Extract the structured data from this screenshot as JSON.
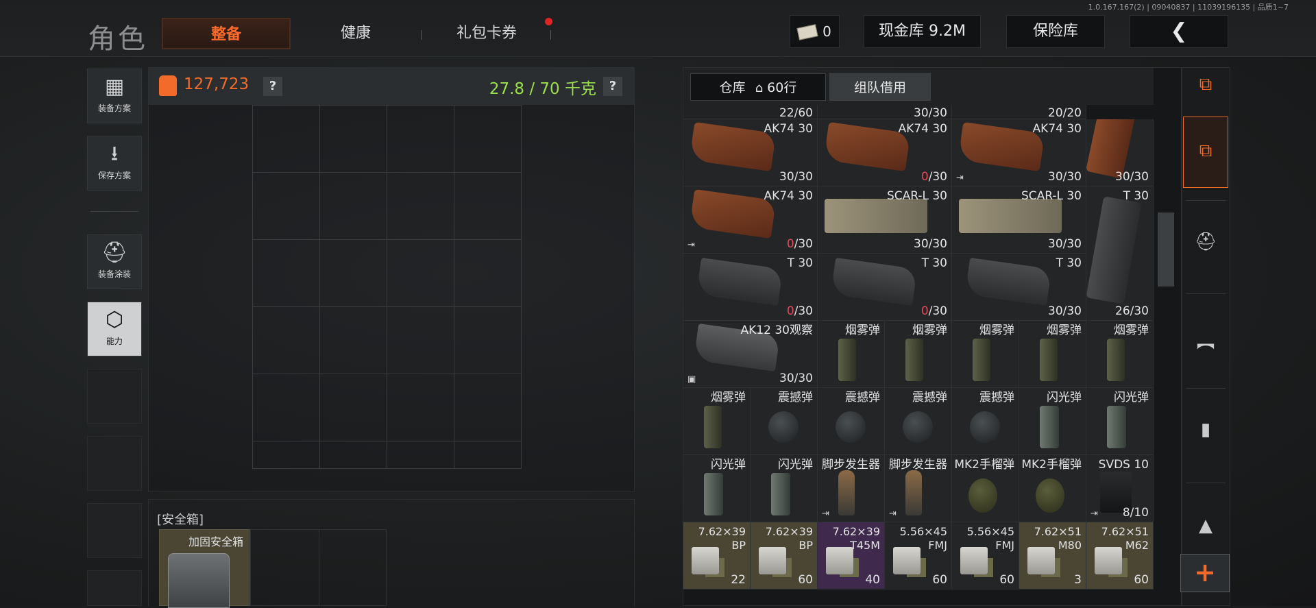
{
  "version": "1.0.167.167(2) | 09040837 | 11039196135 | 品质1~7",
  "header": {
    "brand": "角色",
    "tabs": [
      "整备",
      "健康",
      "礼包卡券"
    ],
    "currency_value": "0",
    "cash": "现金库 9.2M",
    "vault": "保险库",
    "back": "❮"
  },
  "sidebar": {
    "loadout": "装备方案",
    "save": "保存方案",
    "skin": "装备涂装",
    "ability": "能力"
  },
  "equip": {
    "value": "127,723",
    "weight": "27.8 / 70 千克",
    "help": "?"
  },
  "safe_box": {
    "title": "[安全箱]",
    "item": "加固安全箱"
  },
  "inventory": {
    "tab_storage": "仓库",
    "rows": "60行",
    "tab_team": "组队借用",
    "top_counts": [
      "22/60",
      "30/30",
      "20/20"
    ],
    "cells": [
      {
        "name": "AK74 30",
        "count": "30/30",
        "zero": false,
        "corner": "",
        "bg": "",
        "icon": "mag-brown"
      },
      {
        "name": "AK74 30",
        "count": "0/30",
        "zero": true,
        "corner": "",
        "bg": "",
        "icon": "mag-brown"
      },
      {
        "name": "AK74 30",
        "count": "30/30",
        "zero": false,
        "corner": "⇥",
        "bg": "",
        "icon": "mag-brown"
      },
      {
        "name": "",
        "count": "30/30",
        "zero": false,
        "corner": "",
        "bg": "",
        "icon": "mag-brown-v"
      },
      {
        "name": "AK74 30",
        "count": "0/30",
        "zero": true,
        "corner": "⇥",
        "bg": "",
        "icon": "mag-brown"
      },
      {
        "name": "SCAR-L 30",
        "count": "30/30",
        "zero": false,
        "corner": "",
        "bg": "",
        "icon": "mag-tan"
      },
      {
        "name": "SCAR-L 30",
        "count": "30/30",
        "zero": false,
        "corner": "",
        "bg": "",
        "icon": "mag-tan"
      },
      {
        "name": "T 30",
        "count": "26/30",
        "zero": false,
        "corner": "",
        "bg": "",
        "icon": "mag-black-v"
      },
      {
        "name": "T 30",
        "count": "0/30",
        "zero": true,
        "corner": "",
        "bg": "",
        "icon": "mag-black"
      },
      {
        "name": "T 30",
        "count": "0/30",
        "zero": true,
        "corner": "",
        "bg": "",
        "icon": "mag-black"
      },
      {
        "name": "T 30",
        "count": "30/30",
        "zero": false,
        "corner": "",
        "bg": "",
        "icon": "mag-black"
      },
      {
        "name": "AK12 30观察",
        "count": "30/30",
        "zero": false,
        "corner": "▣",
        "bg": "",
        "icon": "mag-clear"
      },
      {
        "name": "烟雾弹",
        "count": "",
        "zero": false,
        "corner": "",
        "bg": "",
        "icon": "smoke"
      },
      {
        "name": "烟雾弹",
        "count": "",
        "zero": false,
        "corner": "",
        "bg": "",
        "icon": "smoke"
      },
      {
        "name": "烟雾弹",
        "count": "",
        "zero": false,
        "corner": "",
        "bg": "",
        "icon": "smoke"
      },
      {
        "name": "烟雾弹",
        "count": "",
        "zero": false,
        "corner": "",
        "bg": "",
        "icon": "smoke"
      },
      {
        "name": "烟雾弹",
        "count": "",
        "zero": false,
        "corner": "",
        "bg": "",
        "icon": "smoke"
      },
      {
        "name": "烟雾弹",
        "count": "",
        "zero": false,
        "corner": "",
        "bg": "",
        "icon": "smoke"
      },
      {
        "name": "震撼弹",
        "count": "",
        "zero": false,
        "corner": "",
        "bg": "",
        "icon": "stun"
      },
      {
        "name": "震撼弹",
        "count": "",
        "zero": false,
        "corner": "",
        "bg": "",
        "icon": "stun"
      },
      {
        "name": "震撼弹",
        "count": "",
        "zero": false,
        "corner": "",
        "bg": "",
        "icon": "stun"
      },
      {
        "name": "震撼弹",
        "count": "",
        "zero": false,
        "corner": "",
        "bg": "",
        "icon": "stun"
      },
      {
        "name": "闪光弹",
        "count": "",
        "zero": false,
        "corner": "",
        "bg": "",
        "icon": "flash"
      },
      {
        "name": "闪光弹",
        "count": "",
        "zero": false,
        "corner": "",
        "bg": "",
        "icon": "flash"
      },
      {
        "name": "闪光弹",
        "count": "",
        "zero": false,
        "corner": "",
        "bg": "",
        "icon": "flash"
      },
      {
        "name": "闪光弹",
        "count": "",
        "zero": false,
        "corner": "",
        "bg": "",
        "icon": "flash"
      },
      {
        "name": "脚步发生器",
        "count": "",
        "zero": false,
        "corner": "⇥",
        "bg": "",
        "icon": "decoy"
      },
      {
        "name": "脚步发生器",
        "count": "",
        "zero": false,
        "corner": "⇥",
        "bg": "",
        "icon": "decoy"
      },
      {
        "name": "MK2手榴弹",
        "count": "",
        "zero": false,
        "corner": "",
        "bg": "",
        "icon": "frag"
      },
      {
        "name": "MK2手榴弹",
        "count": "",
        "zero": false,
        "corner": "",
        "bg": "",
        "icon": "frag"
      },
      {
        "name": "SVDS 10",
        "count": "8/10",
        "zero": false,
        "corner": "⇥",
        "bg": "",
        "icon": "mag-small"
      },
      {
        "name": "7.62×39\nBP",
        "count": "22",
        "zero": false,
        "corner": "",
        "bg": "gold",
        "icon": "ammo"
      },
      {
        "name": "7.62×39\nBP",
        "count": "60",
        "zero": false,
        "corner": "",
        "bg": "gold",
        "icon": "ammo"
      },
      {
        "name": "7.62×39\nT45M",
        "count": "40",
        "zero": false,
        "corner": "",
        "bg": "purp",
        "icon": "ammo"
      },
      {
        "name": "5.56×45\nFMJ",
        "count": "60",
        "zero": false,
        "corner": "",
        "bg": "",
        "icon": "ammo"
      },
      {
        "name": "5.56×45\nFMJ",
        "count": "60",
        "zero": false,
        "corner": "",
        "bg": "",
        "icon": "ammo"
      },
      {
        "name": "7.62×51\nM80",
        "count": "3",
        "zero": false,
        "corner": "",
        "bg": "gold",
        "icon": "ammo"
      },
      {
        "name": "7.62×51\nM62",
        "count": "60",
        "zero": false,
        "corner": "",
        "bg": "gold",
        "icon": "ammo"
      }
    ]
  },
  "filter_icons": [
    "sort-icon",
    "all-items-icon",
    "helmet-icon",
    "rifle-icon",
    "magazine-icon",
    "ammo-icon"
  ],
  "add_button": "+",
  "colors": {
    "accent": "#ff6b2b",
    "weight": "#9be04a",
    "zero": "#e64a5a",
    "gold": "#4b4533",
    "purple": "#3f2a4e"
  }
}
